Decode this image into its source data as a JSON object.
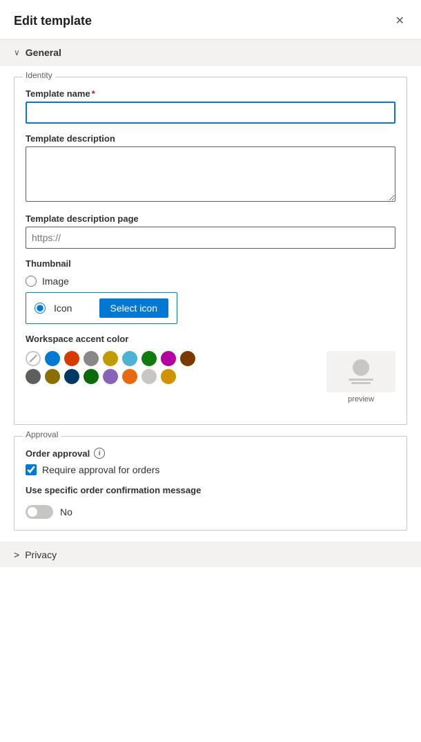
{
  "header": {
    "title": "Edit template",
    "close_label": "✕"
  },
  "general_section": {
    "label": "General",
    "chevron": "∨"
  },
  "identity": {
    "legend": "Identity",
    "template_name_label": "Template name",
    "required": "*",
    "template_name_value": "",
    "template_description_label": "Template description",
    "template_description_value": "",
    "template_description_page_label": "Template description page",
    "template_description_page_placeholder": "https://",
    "thumbnail_label": "Thumbnail",
    "image_radio_label": "Image",
    "icon_radio_label": "Icon",
    "select_icon_label": "Select icon",
    "workspace_accent_color_label": "Workspace accent color",
    "preview_label": "preview"
  },
  "colors": {
    "row1": [
      {
        "id": "none",
        "hex": "none"
      },
      {
        "id": "blue",
        "hex": "#0078d4"
      },
      {
        "id": "orange",
        "hex": "#d83b01"
      },
      {
        "id": "gray",
        "hex": "#8a8886"
      },
      {
        "id": "yellow",
        "hex": "#c19c00"
      },
      {
        "id": "light-blue",
        "hex": "#4db2d4"
      },
      {
        "id": "green",
        "hex": "#107c10"
      },
      {
        "id": "magenta",
        "hex": "#b4009e"
      },
      {
        "id": "brown",
        "hex": "#7a3b00"
      }
    ],
    "row2": [
      {
        "id": "dark-gray",
        "hex": "#605e5c"
      },
      {
        "id": "olive",
        "hex": "#8a7000"
      },
      {
        "id": "navy",
        "hex": "#003966"
      },
      {
        "id": "dark-green",
        "hex": "#0b6a0b"
      },
      {
        "id": "purple",
        "hex": "#8764b8"
      },
      {
        "id": "peach",
        "hex": "#e86a10"
      },
      {
        "id": "silver",
        "hex": "#c8c6c4"
      },
      {
        "id": "gold",
        "hex": "#d29200"
      }
    ]
  },
  "approval": {
    "legend": "Approval",
    "order_approval_label": "Order approval",
    "require_approval_label": "Require approval for orders",
    "require_approval_checked": true,
    "specific_message_label": "Use specific order confirmation message",
    "toggle_label": "No",
    "toggle_on": false
  },
  "privacy_section": {
    "label": "Privacy",
    "chevron": ">"
  }
}
